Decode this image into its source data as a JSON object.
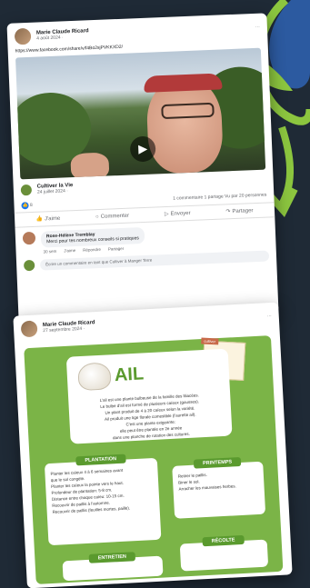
{
  "post1": {
    "author": "Marie Claude Ricard",
    "date": "4 août 2024 ·",
    "link": "https://www.facebook.com/share/v/f4Bo2sjPVKKXD2/",
    "play_icon": "play-icon",
    "shared_page": "Cultiver la Vie",
    "shared_date": "24 juillet 2024 ·",
    "reaction_count": "8",
    "stats": "1 commentaire  1 partage  Vu par 20 personnes",
    "actions": {
      "like": "J'aime",
      "comment": "Commenter",
      "send": "Envoyer",
      "share": "Partager"
    },
    "comment": {
      "author": "Rose-Hélène Tremblay",
      "text": "Merci pour tes nombreux conseils si pratiques",
      "meta": [
        "30 sem",
        "J'aime",
        "Répondre",
        "Partager"
      ]
    },
    "comment_placeholder": "Écrire un commentaire en tant que Cultiver à Manger Terre",
    "more": "···"
  },
  "post2": {
    "author": "Marie Claude Ricard",
    "date": "27 septembre 2024 ·",
    "more": "···",
    "infographic": {
      "stamp": "cultiver",
      "title": "AIL",
      "description": [
        "L'ail est une plante bulbeuse de la famille des liliacées.",
        "Le bulbe d'ail est formé de plusieurs caïeux (gousses).",
        "Un plant produit de 4 à 20 caïeux selon la variété.",
        "Ail produit une tige florale comestible (l'aurette ail).",
        "C'est une plante exigeante:",
        "elle peut être plantée en 2e année",
        "dans une planche de rotation des cultures."
      ],
      "plantation": {
        "label": "PLANTATION",
        "lines": [
          "Planter les caïeux 4 à 6 semaines avant",
          "que le sol congèle.",
          "Planter les caïeux la pointe vers le haut.",
          "Profondeur de plantation: 5-8 cm.",
          "Distance entre chaque caïeu: 10-15 cm.",
          "Recouvrir de paillis à l'automne.",
          "Recouvrir de paillis (feuilles mortes, paille)."
        ]
      },
      "printemps": {
        "label": "PRINTEMPS",
        "lines": [
          "Retirer le paillis.",
          "Biner le sol.",
          "Arracher les mauvaises herbes."
        ]
      },
      "entretien": {
        "label": "ENTRETIEN"
      },
      "recolte": {
        "label": "RÉCOLTE"
      }
    }
  }
}
